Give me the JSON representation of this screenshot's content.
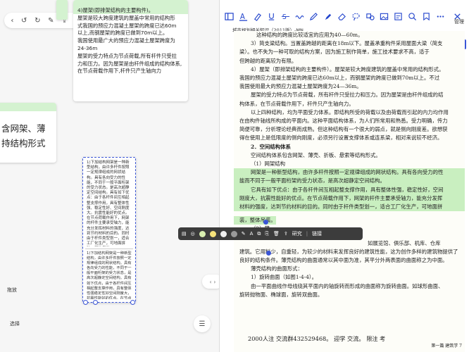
{
  "left_panel": {
    "nav": {
      "back": "‹",
      "undo": "↺",
      "redo": "↻",
      "edit": "✎",
      "share": "⇪",
      "menu": "≡"
    },
    "top_card_lines": [
      "4)屋架(即排架结构的主要构件)。",
      "屋架是较大跨度建筑的屋盖中常用的结构形",
      "式我国的预应力混凝土屋架的跨度已达60m",
      "以上,而钢屋架的跨度已做到70m以上。",
      "我国使用最广大的预应力混凝土屋架跨度为",
      "24-36m",
      "屋架的受力特点为节点荷载,所有杆件只受拉",
      "力和压力。因为屋架是由杆件组成的结构体系,",
      "在节点荷载作用下,杆件只产生轴向力"
    ],
    "side_card_text": "含网架、薄\n持结构形式",
    "mid_card_text": "1)下加结构网架是一种新型结构，由许多杆件按照一定规律组成的网状结构。具有各向受力的性能，不同于一般平面桁架的受力状态。是高次超静定空间结构。具有如下优点：由于各杆件间互相起整支撑作用，具有整体性强、稳定性好、空间刚度大。抗震性能好的优点。在节点荷载作用下，网架的杆件主要承受轴力，能充分发挥材料的强度，达到节约材料的目的。同时由于杆件类型划一，适合工厂化生产，可地面拼装，整体吊装",
    "mid_card_small": "1)下加结构网架是一种新型结构，由许多杆件按照一定规律组成的网状结构。具有各向受力的性能，不同于一般平面桁架的受力状态，是高次超静定空间结构。具有如下优点，由于各杆件间互相起整支撑作用，具有整体性强稳定性好空间刚度大，抗震性能好的优点。在节点荷载作用下,网架的杆件主要承受轴力,能充分发挥材料的强度,达到节约材料的目的。同时由于杆件类型划一,适合工厂化生产,可地面拼装,整体吊装",
    "buttons": {
      "drag": "拖放",
      "select": "选择"
    },
    "toggle": "‹ ›"
  },
  "right_panel": {
    "manage_label": "管理",
    "header": "城市规划相关知识（2011版）-MN...",
    "lines": [
      "这种结构的跨度比较适宜的应用为40—60m。",
      "3）简支梁结构。当置盖跨越的距离在18m以下。屋盖承重构件采用屋面大梁（简支",
      "梁）。也不失为一种可取的结构方案，因为施工制作简单，施工技术要求不高，适于",
      "但跨越的距离较为有限。",
      "4）屋架（即排架结构的主要构件）。屋架是较大跨度建筑的屋盖中常用的结构形式。",
      "我国的预应力混凝土屋架的跨度已达60m以上，而钢屋架的跨度已做到70m以上。不过",
      "我国使用最大的预应力混凝土屋架跨度为24—36m。",
      "屋架的受力特点为节点荷载，所有杆件只受拉力和压力。因为屋架是由杆件组成的结",
      "构体系，在节点荷载作用下，杆件只产生轴向力。",
      "以上四种结构，均为平面受力体系。即结构所受的荷载以及由荷载而引起的内力均作用",
      "在由构件轴线所构成的平面内。这种平面结构体系，为人们所常用和熟悉。受力明确，传力",
      "简便可靠，分析理论经典而成熟。但这种结构有一个很大的弱点，就是侧向刚度差。欲想获",
      "得在使用上是低限度的侧向刚度，必须另行设置支撑体系或连系梁，相对来说较不经济。",
      "2．空间结构体系",
      "空间结构体系包含网架、薄壳、折板、悬索等结构形式。",
      "（1）网架结构",
      "网架是一种新型结构，由许多杆件按照一定规律组成的网状结构。具有各向受力的性",
      "能而不同于一般平面桁架的受力状态，是高次超静定空间结构。",
      "它具有如下优点：由于各杆件间互相起整支撑作用，具有整体性强，稳定性好，空间",
      "刚度大，抗震性能好的优点。在节点荷载作用下，网架的杆件主要承受轴力，能充分发挥",
      "材料的强度，达到节约材料的目的。同时由于杆件类型划一，适合工厂化生产，可地面拼",
      "装，整体吊装。",
      "（2）薄",
      "如展览馆、俱乐部、机库、仓库",
      "建筑。它用料少，自重轻，为较少的材料来发挥良好的建筑性能，这为创作多样的建筑物提供了",
      "良好的结构条件。薄壳结构的曲面通常以其中面为准，其平分外两表面的曲面称之为中面。",
      "薄壳结构的曲面形式：",
      "1）旋转曲面（如图1-4-4）。",
      "由一平面曲线作母线绕其平面内的轴旋转而形成的曲面称为旋转曲面。如球形曲面、",
      "旋转抛物面、椭球面，旋转双曲面。"
    ],
    "footer": "2000人注  交流群432529468。  迎学  交流。    限注  考",
    "page_footer": "第一篇  建筑学   7",
    "popup": {
      "note": "▤",
      "palette": "◎",
      "research": "研究",
      "link": "链接"
    }
  },
  "colors": {
    "highlight": "#c9efc0",
    "dashed": "#3a55d6",
    "toolbar_active": "#2244cc",
    "popup_bg": "#3c3c3c"
  }
}
